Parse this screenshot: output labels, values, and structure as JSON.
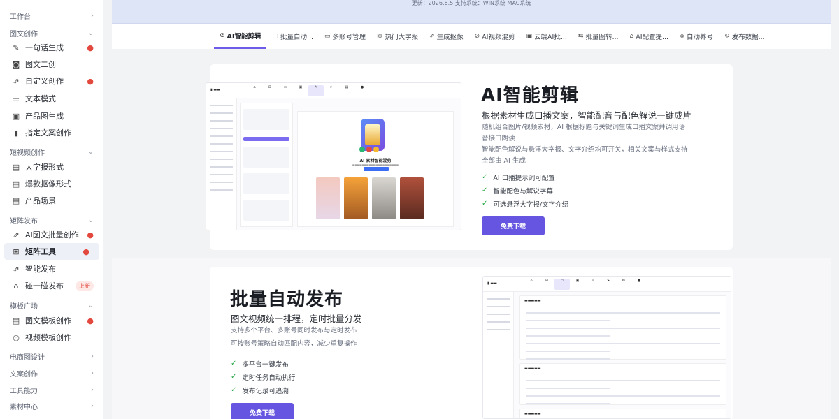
{
  "sidebar": {
    "rows": [
      {
        "kind": "group",
        "label": "工作台",
        "chev": "›"
      },
      {
        "kind": "group",
        "label": "图文创作",
        "chev": "⌄"
      },
      {
        "kind": "item",
        "label": "一句话生成",
        "icon": "✎",
        "icon_name": "pencil-icon",
        "apple": true
      },
      {
        "kind": "item",
        "label": "图文二创",
        "icon": "◙",
        "icon_name": "camera-icon",
        "apple": false
      },
      {
        "kind": "item",
        "label": "自定义创作",
        "icon": "⇗",
        "icon_name": "share-icon",
        "apple": true
      },
      {
        "kind": "item",
        "label": "文本模式",
        "icon": "☰",
        "icon_name": "document-icon",
        "apple": false
      },
      {
        "kind": "item",
        "label": "产品图生成",
        "icon": "▣",
        "icon_name": "image-icon",
        "apple": false
      },
      {
        "kind": "item",
        "label": "指定文案创作",
        "icon": "▮",
        "icon_name": "file-icon",
        "apple": false
      },
      {
        "kind": "group",
        "label": "短视频创作",
        "chev": "⌄"
      },
      {
        "kind": "item",
        "label": "大字报形式",
        "icon": "▤",
        "icon_name": "template-icon",
        "apple": false
      },
      {
        "kind": "item",
        "label": "爆款抠像形式",
        "icon": "▤",
        "icon_name": "template-icon",
        "apple": false
      },
      {
        "kind": "item",
        "label": "产品场景",
        "icon": "▤",
        "icon_name": "template-icon",
        "apple": false
      },
      {
        "kind": "group",
        "label": "矩阵发布",
        "chev": "⌄"
      },
      {
        "kind": "item",
        "label": "AI图文批量创作",
        "icon": "⇗",
        "icon_name": "share-icon",
        "apple": true
      },
      {
        "kind": "item",
        "label": "矩阵工具",
        "icon": "⊞",
        "icon_name": "grid-icon",
        "apple": true,
        "active": true
      },
      {
        "kind": "item",
        "label": "智能发布",
        "icon": "⇗",
        "icon_name": "share-icon",
        "apple": false
      },
      {
        "kind": "item",
        "label": "碰一碰发布",
        "icon": "⌂",
        "icon_name": "home-icon",
        "apple": false,
        "badge": "上新"
      },
      {
        "kind": "group",
        "label": "模板广场",
        "chev": "⌄"
      },
      {
        "kind": "item",
        "label": "图文模板创作",
        "icon": "▤",
        "icon_name": "template-icon",
        "apple": true
      },
      {
        "kind": "item",
        "label": "视频模板创作",
        "icon": "◎",
        "icon_name": "video-icon",
        "apple": false
      },
      {
        "kind": "group",
        "label": "电商图设计",
        "chev": "›"
      },
      {
        "kind": "group",
        "label": "文案创作",
        "chev": "›"
      },
      {
        "kind": "group",
        "label": "工具能力",
        "chev": "›"
      },
      {
        "kind": "group",
        "label": "素材中心",
        "chev": "›"
      }
    ]
  },
  "banner": {
    "text": "更新：2026.6.5    支持系统：WIN系统 MAC系统"
  },
  "tabs": [
    {
      "label": "AI智能剪辑",
      "icon": "⊘",
      "active": true
    },
    {
      "label": "批量自动...",
      "icon": "▢"
    },
    {
      "label": "多账号管理",
      "icon": "▭"
    },
    {
      "label": "热门大字报",
      "icon": "▧"
    },
    {
      "label": "生成抠像",
      "icon": "⇗"
    },
    {
      "label": "AI视频混剪",
      "icon": "⊘"
    },
    {
      "label": "云端AI批...",
      "icon": "▣"
    },
    {
      "label": "批量图转...",
      "icon": "⇆"
    },
    {
      "label": "AI配置提...",
      "icon": "⌂"
    },
    {
      "label": "自动养号",
      "icon": "◈"
    },
    {
      "label": "发布数据...",
      "icon": "↻"
    }
  ],
  "section1": {
    "title": "AI智能剪辑",
    "lead": "根据素材生成口播文案，智能配音与配色解说一键成片",
    "para1": "随机组合图片/视频素材，AI 根据标题与关键词生成口播文案并调用语音接口朗读",
    "para2": "智能配色解说与悬浮大字报、文字介绍均可开关，相关文案与样式支持全部由 AI 生成",
    "checks": [
      "AI 口播提示词可配置",
      "智能配色与解说字幕",
      "可选悬浮大字报/文字介绍"
    ],
    "button": "免费下载",
    "shot_title": "AI 素材智能混剪"
  },
  "section2": {
    "title": "批量自动发布",
    "lead": "图文视频统一排程，定时批量分发",
    "para1": "支持多个平台、多账号同时发布与定时发布",
    "para2": "可按账号策略自动匹配内容，减少重复操作",
    "checks": [
      "多平台一键发布",
      "定时任务自动执行",
      "发布记录可追溯"
    ],
    "button": "免费下载"
  },
  "colors": {
    "accent": "#6655e0",
    "apple": "#e2483d",
    "check": "#28a745"
  }
}
